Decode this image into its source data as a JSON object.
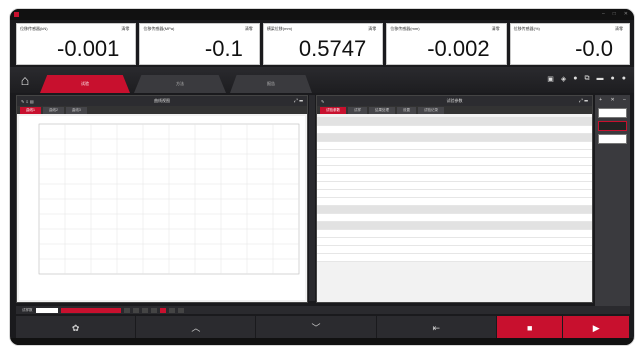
{
  "meters": [
    {
      "label": "位移传感器(kN)",
      "unit": "清零",
      "value": "-0.001"
    },
    {
      "label": "位移传感器(MPa)",
      "unit": "清零",
      "value": "-0.1"
    },
    {
      "label": "横梁位移(mm)",
      "unit": "清零",
      "value": "0.5747"
    },
    {
      "label": "位移传感器(mm)",
      "unit": "清零",
      "value": "-0.002"
    },
    {
      "label": "位移传感器(%)",
      "unit": "清零",
      "value": "-0.0"
    }
  ],
  "nav": {
    "tabs": [
      "试验",
      "方法",
      "报告"
    ]
  },
  "left_panel": {
    "title": "曲线视图",
    "subtabs": [
      "曲线1",
      "曲线2",
      "曲线3"
    ]
  },
  "right_panel": {
    "title": "试验参数",
    "subtabs": [
      "试验参数",
      "试样",
      "结果处理",
      "设置",
      "试验记录"
    ]
  },
  "status": {
    "label": "试样数"
  },
  "bottom_buttons": [
    {
      "icon": "gear-icon"
    },
    {
      "icon": "chevron-up-icon"
    },
    {
      "icon": "chevron-down-icon"
    },
    {
      "icon": "stop-bar-icon"
    },
    {
      "icon": "stop-square-icon"
    },
    {
      "icon": "play-icon"
    }
  ],
  "colors": {
    "accent": "#c8102e",
    "dark": "#1a1a1d"
  }
}
